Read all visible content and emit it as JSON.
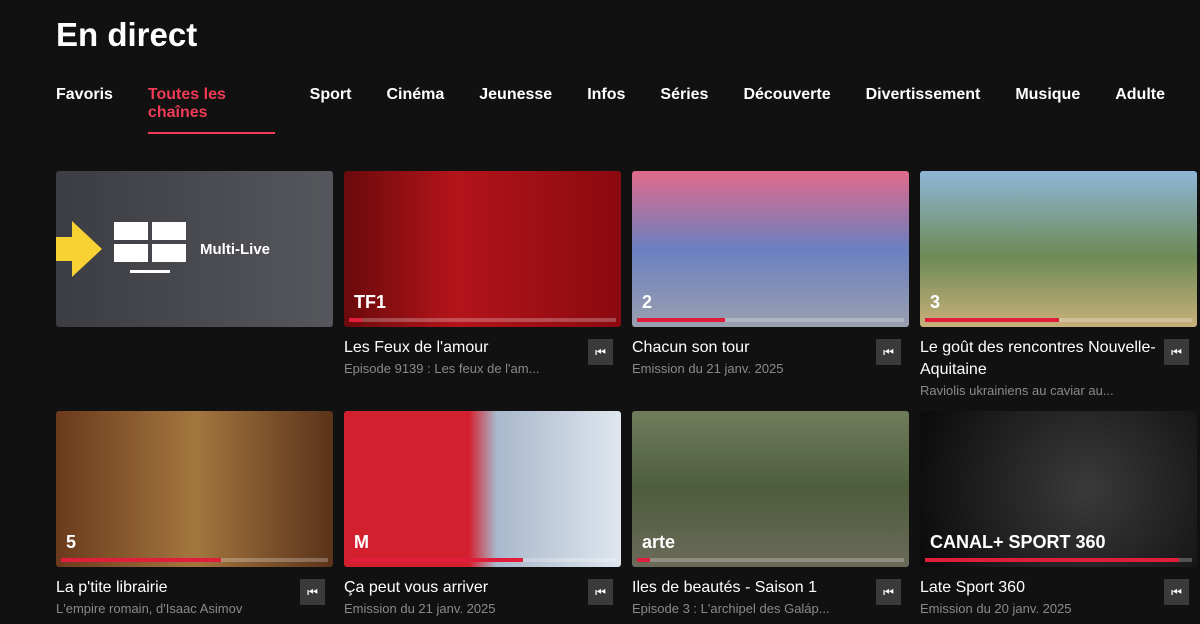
{
  "page_title": "En direct",
  "tabs": [
    {
      "label": "Favoris"
    },
    {
      "label": "Toutes les chaînes",
      "active": true
    },
    {
      "label": "Sport"
    },
    {
      "label": "Cinéma"
    },
    {
      "label": "Jeunesse"
    },
    {
      "label": "Infos"
    },
    {
      "label": "Séries"
    },
    {
      "label": "Découverte"
    },
    {
      "label": "Divertissement"
    },
    {
      "label": "Musique"
    },
    {
      "label": "Adulte"
    }
  ],
  "multi_live": {
    "label": "Multi-Live",
    "icon": "grid-screen-icon",
    "arrow": "arrow-right-icon",
    "arrow_color": "#f7d232"
  },
  "accent": "#ef3b55",
  "channels": [
    {
      "title": "Les Feux de l'amour",
      "subtitle": "Episode 9139 : Les feux de l'am...",
      "channel": "TF1",
      "progress": 5,
      "bg": "linear-gradient(90deg,#6a0a0c,#b3141a 40%,#8a0a10)"
    },
    {
      "title": "Chacun son tour",
      "subtitle": "Emission du 21 janv. 2025",
      "channel": "2",
      "progress": 33,
      "bg": "linear-gradient(180deg,#e06a8a,#6a7fc0 50%,#9aa0b0)"
    },
    {
      "title": "Le goût des rencontres Nouvelle-Aquitaine",
      "subtitle": "Raviolis ukrainiens au caviar au...",
      "channel": "3",
      "progress": 50,
      "bg": "linear-gradient(180deg,#8fb6d8,#6d8a55 55%,#c9b07a)"
    },
    {
      "title": "La p'tite librairie",
      "subtitle": "L'empire romain, d'Isaac Asimov",
      "channel": "5",
      "progress": 60,
      "bg": "linear-gradient(90deg,#6b3a1c,#a4763f 50%,#5a331a)"
    },
    {
      "title": "Ça peut vous arriver",
      "subtitle": "Emission du 21 janv. 2025",
      "channel": "M",
      "progress": 65,
      "bg": "linear-gradient(90deg,#d3202e 45%,#a9b8cc 55%,#dfe6ee)"
    },
    {
      "title": "Iles de beautés - Saison 1",
      "subtitle": "Episode 3 : L'archipel des Galáp...",
      "channel": "arte",
      "progress": 5,
      "bg": "linear-gradient(180deg,#6f7d5c,#4e5d3c 50%,#6b6a5a)"
    },
    {
      "title": "Late Sport 360",
      "subtitle": "Emission du 20 janv. 2025",
      "channel": "CANAL+ SPORT 360",
      "progress": 95,
      "bg": "radial-gradient(circle at 60% 50%,#3a3a3a,#0a0a0a)"
    }
  ]
}
